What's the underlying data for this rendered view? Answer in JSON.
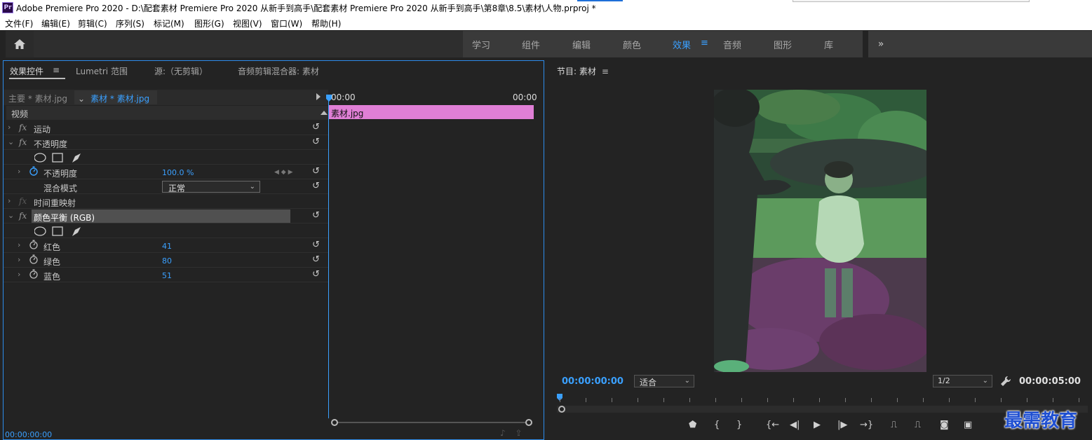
{
  "titlebar": {
    "app_icon": "Pr",
    "title": "Adobe Premiere Pro 2020 - D:\\配套素材 Premiere Pro 2020 从新手到高手\\配套素材 Premiere Pro 2020 从新手到高手\\第8章\\8.5\\素材\\人物.prproj *"
  },
  "menu": [
    "文件(F)",
    "编辑(E)",
    "剪辑(C)",
    "序列(S)",
    "标记(M)",
    "图形(G)",
    "视图(V)",
    "窗口(W)",
    "帮助(H)"
  ],
  "workspaces": {
    "items": [
      "学习",
      "组件",
      "编辑",
      "颜色",
      "效果",
      "音频",
      "图形",
      "库"
    ],
    "active": "效果",
    "menu_icon": "≡",
    "more": "»"
  },
  "left_panel": {
    "tabs": [
      "效果控件",
      "Lumetri 范围",
      "源:（无剪辑）",
      "音频剪辑混合器: 素材"
    ],
    "tab_menu_icon": "≡",
    "master_clip": "主要 * 素材.jpg",
    "sequence_clip": "素材 * 素材.jpg",
    "video_header": "视频",
    "timeline_start": "00:00",
    "timeline_end": "00:00",
    "clip_name": "素材.jpg",
    "effects": {
      "motion": "运动",
      "opacity": "不透明度",
      "opacity_param": "不透明度",
      "opacity_value": "100.0 %",
      "blend_mode_label": "混合模式",
      "blend_mode_value": "正常",
      "time_remap": "时间重映射",
      "color_balance": "颜色平衡 (RGB)",
      "red_label": "红色",
      "red_value": "41",
      "green_label": "绿色",
      "green_value": "80",
      "blue_label": "蓝色",
      "blue_value": "51"
    },
    "current_time": "00:00:00:00"
  },
  "program_monitor": {
    "title": "节目: 素材",
    "menu_icon": "≡",
    "current_time": "00:00:00:00",
    "fit": "适合",
    "resolution": "1/2",
    "duration": "00:00:05:00"
  },
  "watermark": "最需教育",
  "colors": {
    "accent_blue": "#3aa0ff",
    "clip_pink": "#e07fd6",
    "panel_bg": "#232323"
  }
}
